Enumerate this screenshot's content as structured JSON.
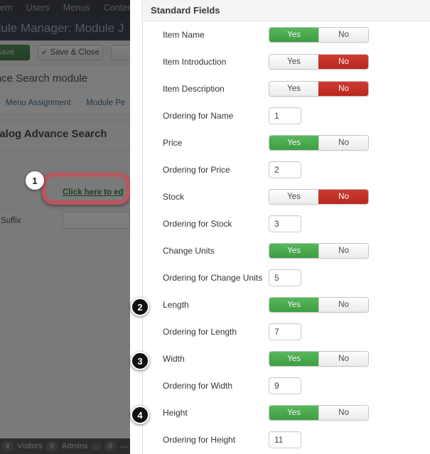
{
  "backdrop": {
    "topnav": [
      "em",
      "Users",
      "Menus",
      "Conten"
    ],
    "page_title": "dule Manager: Module J",
    "toolbar": {
      "save_label": "Save",
      "save_close_label": "Save & Close",
      "check_icon": "✔"
    },
    "subtitle": "vance Search module",
    "tabs": [
      "Menu Assignment",
      "Module Pe"
    ],
    "heading": "atalog Advance Search",
    "edit_link": "Click here to ed",
    "suffix_label": "s Suffix",
    "statusbar": {
      "visitors_count": "4",
      "visitors_label": "Visitors",
      "admins_count": "6",
      "admins_label": "Admins",
      "messages_count": "0",
      "dash": "—"
    }
  },
  "callouts": [
    {
      "number": "1",
      "style": "light"
    },
    {
      "number": "2",
      "style": "dark"
    },
    {
      "number": "3",
      "style": "dark"
    },
    {
      "number": "4",
      "style": "dark"
    }
  ],
  "panel": {
    "title": "Standard Fields",
    "toggle": {
      "yes": "Yes",
      "no": "No"
    },
    "rows": [
      {
        "label": "Item Name",
        "type": "toggle",
        "value": "yes"
      },
      {
        "label": "Item Introduction",
        "type": "toggle",
        "value": "no"
      },
      {
        "label": "Item Description",
        "type": "toggle",
        "value": "no"
      },
      {
        "label": "Ordering for Name",
        "type": "input",
        "value": "1"
      },
      {
        "label": "Price",
        "type": "toggle",
        "value": "yes"
      },
      {
        "label": "Ordering for Price",
        "type": "input",
        "value": "2"
      },
      {
        "label": "Stock",
        "type": "toggle",
        "value": "no"
      },
      {
        "label": "Ordering for Stock",
        "type": "input",
        "value": "3"
      },
      {
        "label": "Change Units",
        "type": "toggle",
        "value": "yes"
      },
      {
        "label": "Ordering for Change Units",
        "type": "input",
        "value": "5"
      },
      {
        "label": "Length",
        "type": "toggle",
        "value": "yes"
      },
      {
        "label": "Ordering for Length",
        "type": "input",
        "value": "7"
      },
      {
        "label": "Width",
        "type": "toggle",
        "value": "yes"
      },
      {
        "label": "Ordering for Width",
        "type": "input",
        "value": "9"
      },
      {
        "label": "Height",
        "type": "toggle",
        "value": "yes"
      },
      {
        "label": "Ordering for Height",
        "type": "input",
        "value": "11"
      }
    ]
  },
  "colors": {
    "green": "#45a847",
    "red": "#c33128",
    "highlight": "#b9565f",
    "link": "#16601f",
    "tab_link": "#1f4e79"
  }
}
